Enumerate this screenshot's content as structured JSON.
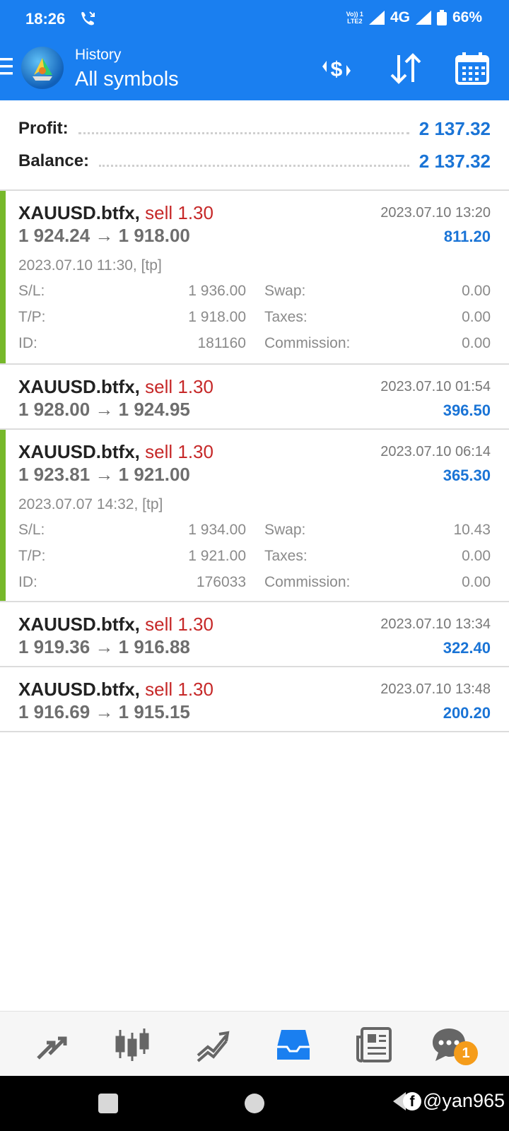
{
  "status_bar": {
    "time": "18:26",
    "volte_line1": "Vo)) 1",
    "volte_line2": "LTE2",
    "network": "4G",
    "battery": "66%"
  },
  "app_bar": {
    "title": "History",
    "subtitle": "All symbols"
  },
  "summary": {
    "profit_label": "Profit:",
    "profit_value": "2 137.32",
    "balance_label": "Balance:",
    "balance_value": "2 137.32"
  },
  "trades": [
    {
      "symbol": "XAUUSD.btfx,",
      "side": "sell 1.30",
      "prices": "1 924.24 → 1 918.00",
      "close_time": "2023.07.10 13:20",
      "profit": "811.20",
      "open_info": "2023.07.10 11:30, [tp]",
      "sl_label": "S/L:",
      "sl": "1 936.00",
      "swap_label": "Swap:",
      "swap": "0.00",
      "tp_label": "T/P:",
      "tp": "1 918.00",
      "taxes_label": "Taxes:",
      "taxes": "0.00",
      "id_label": "ID:",
      "id": "181160",
      "commission_label": "Commission:",
      "commission": "0.00"
    },
    {
      "symbol": "XAUUSD.btfx,",
      "side": "sell 1.30",
      "prices": "1 928.00 → 1 924.95",
      "close_time": "2023.07.10 01:54",
      "profit": "396.50"
    },
    {
      "symbol": "XAUUSD.btfx,",
      "side": "sell 1.30",
      "prices": "1 923.81 → 1 921.00",
      "close_time": "2023.07.10 06:14",
      "profit": "365.30",
      "open_info": "2023.07.07 14:32, [tp]",
      "sl_label": "S/L:",
      "sl": "1 934.00",
      "swap_label": "Swap:",
      "swap": "10.43",
      "tp_label": "T/P:",
      "tp": "1 921.00",
      "taxes_label": "Taxes:",
      "taxes": "0.00",
      "id_label": "ID:",
      "id": "176033",
      "commission_label": "Commission:",
      "commission": "0.00"
    },
    {
      "symbol": "XAUUSD.btfx,",
      "side": "sell 1.30",
      "prices": "1 919.36 → 1 916.88",
      "close_time": "2023.07.10 13:34",
      "profit": "322.40"
    },
    {
      "symbol": "XAUUSD.btfx,",
      "side": "sell 1.30",
      "prices": "1 916.69 → 1 915.15",
      "close_time": "2023.07.10 13:48",
      "profit": "200.20"
    }
  ],
  "bottom_nav": {
    "items": [
      "quotes-icon",
      "chart-icon",
      "trade-icon",
      "history-icon",
      "news-icon",
      "chat-icon"
    ],
    "active": "history-icon",
    "chat_badge": "1"
  },
  "watermark": {
    "fb": "f",
    "handle": "@yan965"
  },
  "colors": {
    "primary": "#1a7ff0",
    "profit_blue": "#1a74d6",
    "sell_red": "#c62828",
    "expanded_bar": "#76b82a",
    "badge": "#f59c1a"
  }
}
